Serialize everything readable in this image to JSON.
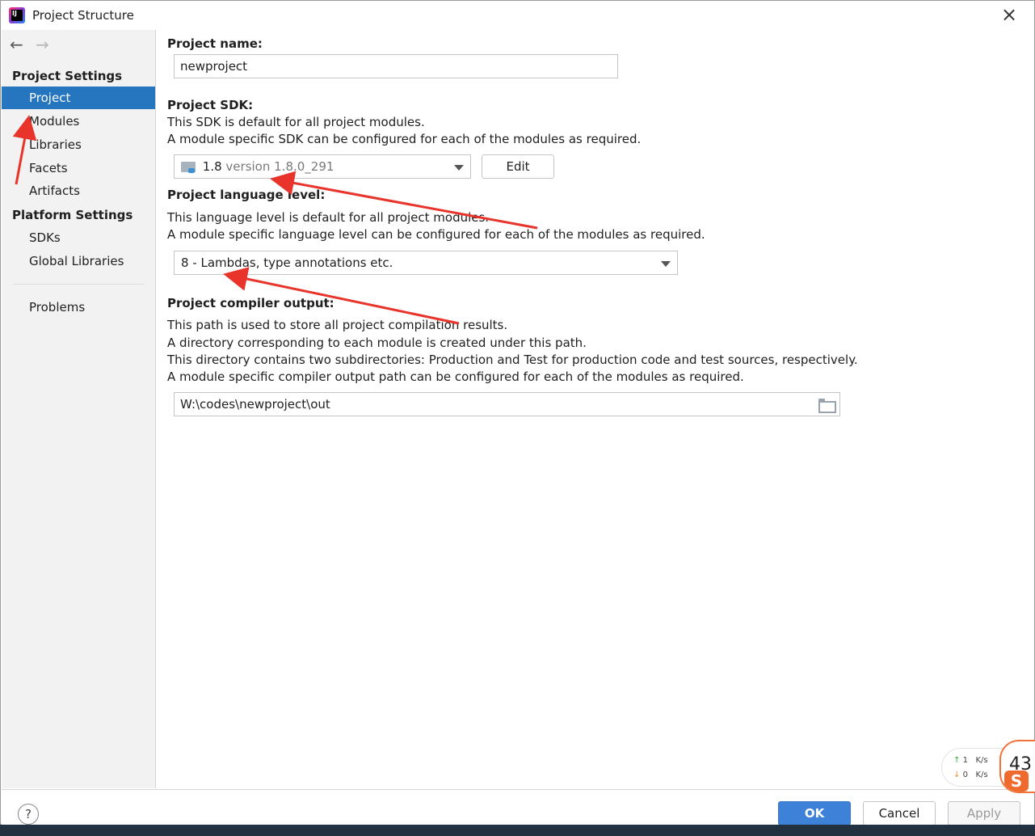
{
  "window": {
    "title": "Project Structure",
    "close_glyph": "×"
  },
  "sidebar": {
    "back_glyph": "←",
    "forward_glyph": "→",
    "project_settings_title": "Project Settings",
    "project_settings_items": [
      "Project",
      "Modules",
      "Libraries",
      "Facets",
      "Artifacts"
    ],
    "selected_item": "Project",
    "platform_settings_title": "Platform Settings",
    "platform_settings_items": [
      "SDKs",
      "Global Libraries"
    ],
    "problems_label": "Problems"
  },
  "content": {
    "project_name": {
      "label": "Project name:",
      "value": "newproject"
    },
    "project_sdk": {
      "label": "Project SDK:",
      "desc_1": "This SDK is default for all project modules.",
      "desc_2": "A module specific SDK can be configured for each of the modules as required.",
      "selected_name": "1.8",
      "selected_detail": "version 1.8.0_291",
      "edit_button": "Edit"
    },
    "language_level": {
      "label": "Project language level:",
      "desc_1": "This language level is default for all project modules.",
      "desc_2": "A module specific language level can be configured for each of the modules as required.",
      "selected": "8 - Lambdas, type annotations etc."
    },
    "compiler_output": {
      "label": "Project compiler output:",
      "desc_1": "This path is used to store all project compilation results.",
      "desc_2": "A directory corresponding to each module is created under this path.",
      "desc_3": "This directory contains two subdirectories: Production and Test for production code and test sources, respectively.",
      "desc_4": "A module specific compiler output path can be configured for each of the modules as required.",
      "path": "W:\\codes\\newproject\\out"
    }
  },
  "footer": {
    "help_glyph": "?",
    "ok_button": "OK",
    "cancel_button": "Cancel",
    "apply_button": "Apply",
    "primary_color": "#3d82d8",
    "selection_color": "#2675bf"
  },
  "overlay": {
    "net_up_value": "1",
    "net_up_unit": "K/s",
    "net_down_value": "0",
    "net_down_unit": "K/s",
    "ime_number": "43",
    "ime_letter": "S",
    "annotation_color": "#e8342b"
  }
}
